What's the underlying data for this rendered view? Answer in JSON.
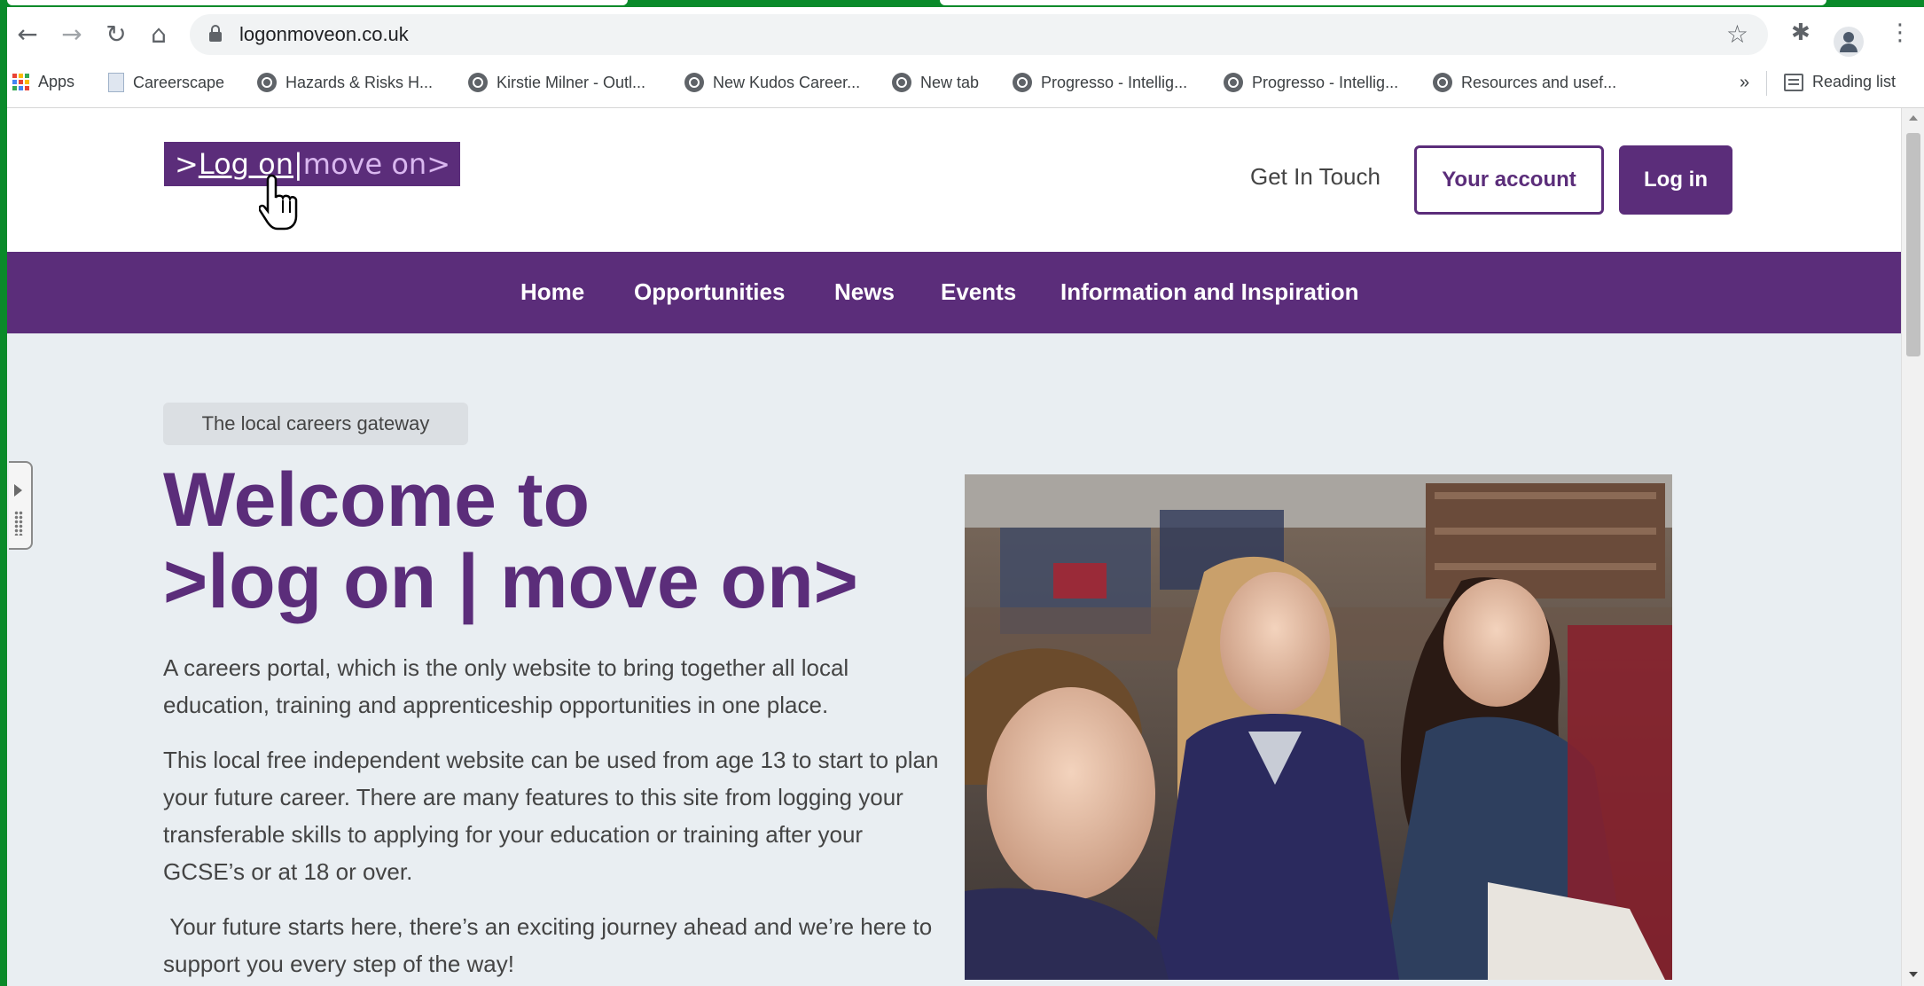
{
  "browser": {
    "url": "logonmoveon.co.uk",
    "bookmarks": [
      {
        "label": "Apps"
      },
      {
        "label": "Careerscape"
      },
      {
        "label": "Hazards & Risks  H..."
      },
      {
        "label": "Kirstie Milner - Outl..."
      },
      {
        "label": "New Kudos Career..."
      },
      {
        "label": "New tab"
      },
      {
        "label": "Progresso - Intellig..."
      },
      {
        "label": "Progresso - Intellig..."
      },
      {
        "label": "Resources and usef..."
      }
    ],
    "overflow_label": "»",
    "reading_list_label": "Reading list"
  },
  "site": {
    "logo": {
      "part1": ">",
      "part2": "Log on",
      "sep": "|",
      "part3": "move on>"
    },
    "header": {
      "get_in_touch": "Get In Touch",
      "your_account": "Your account",
      "log_in": "Log in"
    },
    "nav": [
      {
        "label": "Home"
      },
      {
        "label": "Opportunities"
      },
      {
        "label": "News"
      },
      {
        "label": "Events"
      },
      {
        "label": "Information and Inspiration"
      }
    ],
    "hero": {
      "badge": "The local careers gateway",
      "title_line1": "Welcome to",
      "title_line2": ">log on | move on>",
      "para1": "A careers portal, which is the only website to bring together all local education, training and apprenticeship opportunities in one place.",
      "para2": "This local free independent website can be used from age 13 to start to plan your future career. There are many features to this site from logging your transferable skills to applying for your education or training after your GCSE’s or at 18 or over.",
      "para3": " Your future starts here, there’s an exciting journey ahead and we’re here to support you every step of the way!"
    }
  },
  "colors": {
    "brand_purple": "#5b2d7a",
    "page_bg": "#e9eef2"
  }
}
